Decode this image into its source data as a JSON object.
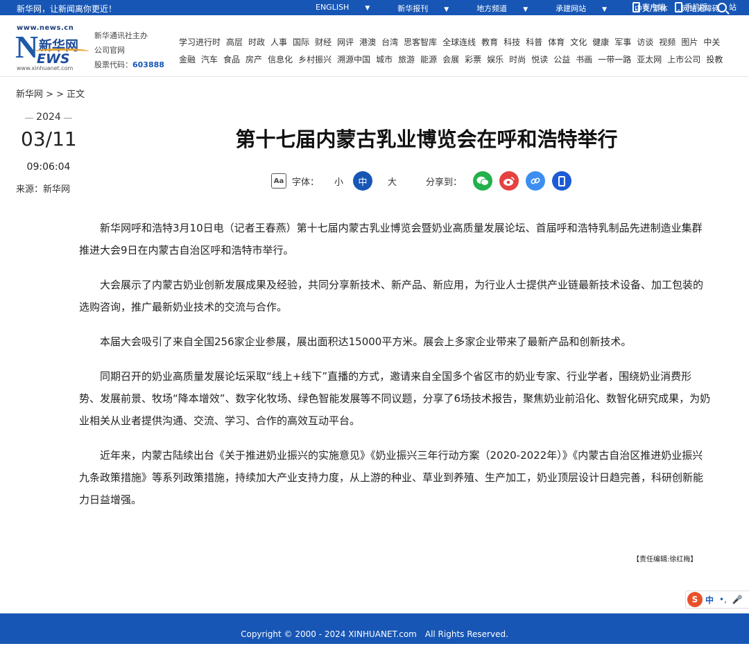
{
  "topbar": {
    "slogan": "新华网，让新闻离你更近！",
    "links": [
      "ENGLISH",
      "新华报刊",
      "地方频道",
      "承建网站",
      "中文/繁体",
      "网站无障碍"
    ],
    "apps": [
      "客户端",
      "手机版",
      "站"
    ]
  },
  "logo": {
    "url_top": "www.news.cn",
    "name": "新华网",
    "n_letter": "N",
    "ews": "EWS",
    "url_bottom": "www.xinhuanet.com"
  },
  "org": {
    "line1": "新华通讯社主办",
    "line2": "公司官网",
    "stock_label": "股票代码：",
    "stock_code": "603888"
  },
  "channels": {
    "row1": [
      "学习进行时",
      "高层",
      "时政",
      "人事",
      "国际",
      "财经",
      "网评",
      "港澳",
      "台湾",
      "思客智库",
      "全球连线",
      "教育",
      "科技",
      "科普",
      "体育",
      "文化",
      "健康",
      "军事",
      "访谈",
      "视频",
      "图片",
      "中关"
    ],
    "row2": [
      "金融",
      "汽车",
      "食品",
      "房产",
      "信息化",
      "乡村振兴",
      "溯源中国",
      "城市",
      "旅游",
      "能源",
      "会展",
      "彩票",
      "娱乐",
      "时尚",
      "悦读",
      "公益",
      "书画",
      "一带一路",
      "亚太网",
      "上市公司",
      "投教"
    ]
  },
  "breadcrumb": "新华网 > > 正文",
  "date": {
    "year": "2024",
    "month_day": "03/11",
    "time": "09:06:04",
    "source": "来源：新华网"
  },
  "title": "第十七届内蒙古乳业博览会在呼和浩特举行",
  "tools": {
    "aa": "Aa",
    "font_label": "字体：",
    "small": "小",
    "medium": "中",
    "large": "大",
    "share_label": "分享到："
  },
  "article": [
    "新华网呼和浩特3月10日电（记者王春燕）第十七届内蒙古乳业博览会暨奶业高质量发展论坛、首届呼和浩特乳制品先进制造业集群推进大会9日在内蒙古自治区呼和浩特市举行。",
    "大会展示了内蒙古奶业创新发展成果及经验，共同分享新技术、新产品、新应用，为行业人士提供产业链最新技术设备、加工包装的选购咨询，推广最新奶业技术的交流与合作。",
    "本届大会吸引了来自全国256家企业参展，展出面积达15000平方米。展会上多家企业带来了最新产品和创新技术。",
    "同期召开的奶业高质量发展论坛采取“线上+线下”直播的方式，邀请来自全国多个省区市的奶业专家、行业学者，围绕奶业消费形势、发展前景、牧场“降本增效”、数字化牧场、绿色智能发展等不同议题，分享了6场技术报告，聚焦奶业前沿化、数智化研究成果，为奶业相关从业者提供沟通、交流、学习、合作的高效互动平台。",
    "近年来，内蒙古陆续出台《关于推进奶业振兴的实施意见》《奶业振兴三年行动方案（2020-2022年）》《内蒙古自治区推进奶业振兴九条政策措施》等系列政策措施，持续加大产业支持力度，从上游的种业、草业到养殖、生产加工，奶业顶层设计日趋完善，科研创新能力日益增强。"
  ],
  "editor": "【责任编辑:徐红梅】",
  "ime": {
    "s": "S",
    "lang": "中",
    "punct": "•,",
    "mic": "🎤"
  },
  "footer": "Copyright © 2000 - 2024 XINHUANET.com　All Rights Reserved."
}
